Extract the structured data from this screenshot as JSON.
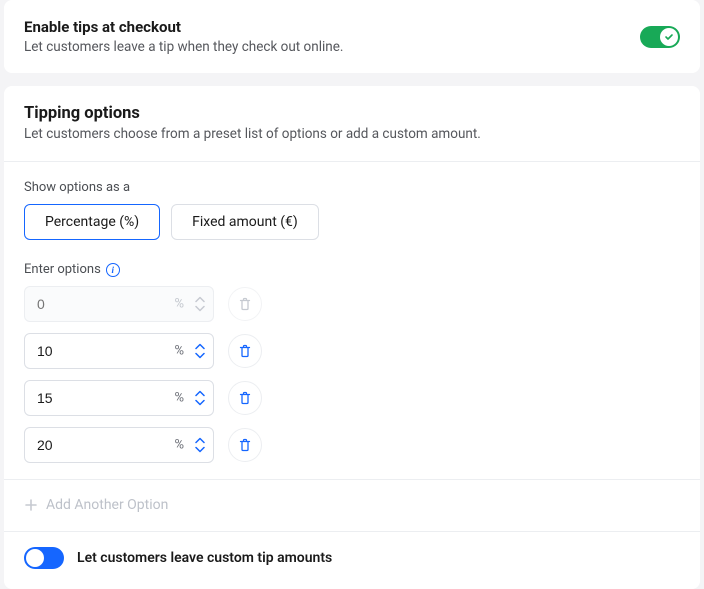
{
  "enable": {
    "title": "Enable tips at checkout",
    "subtitle": "Let customers leave a tip when they check out online."
  },
  "tipping": {
    "title": "Tipping options",
    "subtitle": "Let customers choose from a preset list of options or add a custom amount."
  },
  "show_as": {
    "label": "Show options as a",
    "percentage": "Percentage (%)",
    "fixed": "Fixed amount (€)"
  },
  "enter_options_label": "Enter options",
  "suffix": "%",
  "options": {
    "o0": "0",
    "o1": "10",
    "o2": "15",
    "o3": "20"
  },
  "add_label": "Add Another Option",
  "custom_label": "Let customers leave custom tip amounts",
  "colors": {
    "accent": "#1566ff",
    "success": "#18a957"
  }
}
